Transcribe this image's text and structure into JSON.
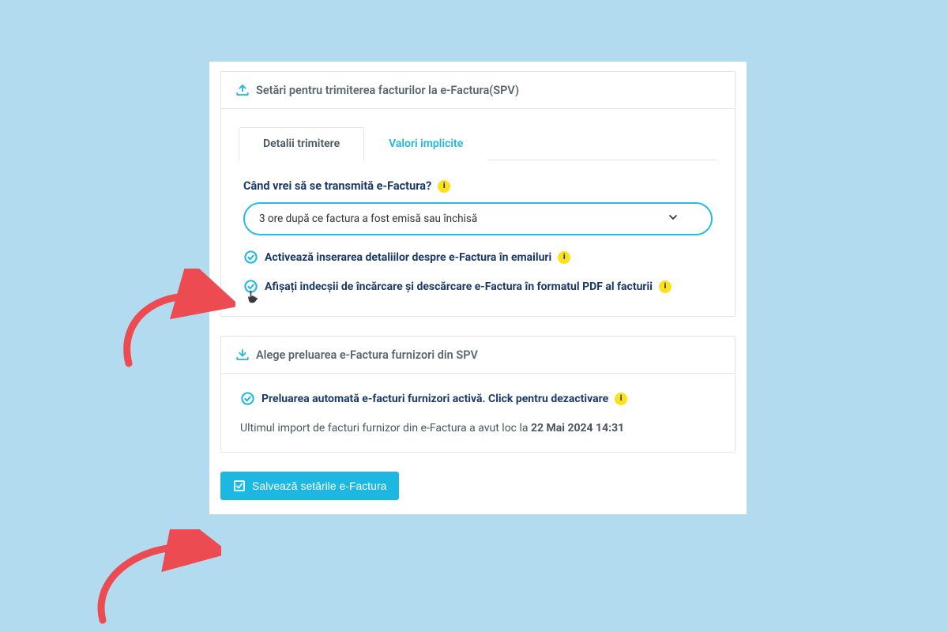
{
  "colors": {
    "accent": "#1db8e2",
    "primaryText": "#1b3a6b",
    "pageBg": "#b3dbef",
    "warnBadge": "#ffe11a",
    "arrow": "#ec4b52"
  },
  "card1": {
    "title": "Setări pentru trimiterea facturilor la e-Factura(SPV)",
    "tabs": {
      "details": "Detalii trimitere",
      "defaults": "Valori implicite"
    },
    "whenLabel": "Când vrei să se transmită e-Factura?",
    "selectValue": "3 ore după ce factura a fost emisă sau închisă",
    "toggle1": "Activează inserarea detaliilor despre e-Factura în emailuri",
    "toggle2": "Afișați indecșii de încărcare și descărcare e-Factura în formatul PDF al facturii"
  },
  "card2": {
    "title": "Alege preluarea e-Factura furnizori din SPV",
    "statusText": "Preluarea automată e-facturi furnizori activă. Click pentru dezactivare",
    "lastImportPrefix": "Ultimul import de facturi furnizor din e-Factura a avut loc la ",
    "lastImportDate": "22 Mai 2024 14:31"
  },
  "saveButton": "Salvează setările e-Factura"
}
